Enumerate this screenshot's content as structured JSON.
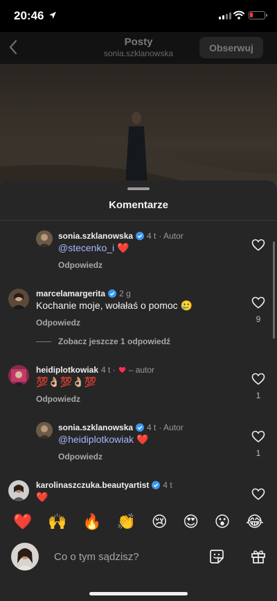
{
  "status_bar": {
    "time": "20:46"
  },
  "header": {
    "title": "Posty",
    "subtitle": "sonia.szklanowska",
    "follow_label": "Obserwuj"
  },
  "sheet": {
    "title": "Komentarze"
  },
  "comments": [
    {
      "user": "sonia.szklanowska",
      "time": "4 t",
      "tag": "· Autor",
      "mention": "@stecenko_i",
      "text": " ❤️",
      "reply": "Odpowiedz",
      "likes": ""
    },
    {
      "user": "marcelamargerita",
      "time": "2 g",
      "tag": "",
      "mention": "",
      "text": "Kochanie moje, wołałaś o pomoc 🥲",
      "reply": "Odpowiedz",
      "likes": "9"
    },
    {
      "user": "heidiplotkowiak",
      "time": "4 t ·",
      "tag": "– autor",
      "mention": "",
      "text": "💯👌🏼💯👌🏼💯",
      "reply": "Odpowiedz",
      "likes": "1"
    },
    {
      "user": "sonia.szklanowska",
      "time": "4 t",
      "tag": "· Autor",
      "mention": "@heidiplotkowiak",
      "text": " ❤️",
      "reply": "Odpowiedz",
      "likes": "1"
    },
    {
      "user": "karolinaszczuka.beautyartist",
      "time": "4 t",
      "tag": "",
      "mention": "",
      "text": "❤️",
      "reply": "",
      "likes": ""
    }
  ],
  "see_more_replies": "Zobacz jeszcze 1 odpowiedź",
  "emoji_reactions": [
    "❤️",
    "🙌",
    "🔥",
    "👏",
    "😢",
    "😍",
    "😮",
    "😂"
  ],
  "composer": {
    "placeholder": "Co o tym sądzisz?"
  },
  "colors": {
    "sheet_bg": "#262626",
    "mention": "#a5b8ff",
    "liked_heart": "#ff2d55",
    "verified": "#3897f0"
  },
  "icons": [
    "location-arrow-icon",
    "cellular-icon",
    "wifi-icon",
    "battery-icon",
    "back-chevron-icon",
    "verified-badge-icon",
    "heart-outline-icon",
    "sticker-icon",
    "gift-icon"
  ]
}
